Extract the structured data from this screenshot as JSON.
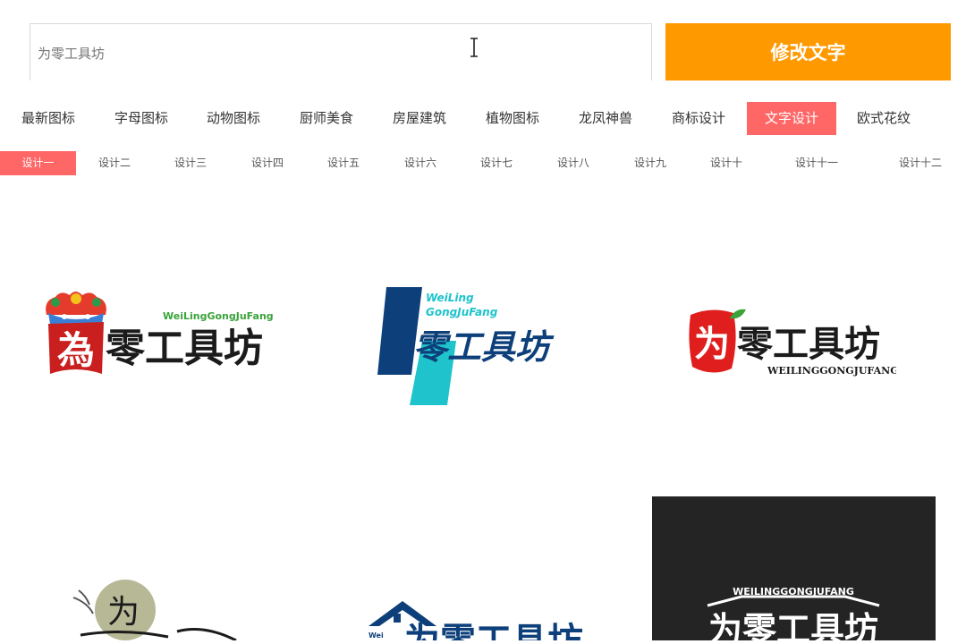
{
  "search": {
    "value": "为零工具坊",
    "button_label": "修改文字"
  },
  "categories": [
    {
      "label": "最新图标",
      "active": false
    },
    {
      "label": "字母图标",
      "active": false
    },
    {
      "label": "动物图标",
      "active": false
    },
    {
      "label": "厨师美食",
      "active": false
    },
    {
      "label": "房屋建筑",
      "active": false
    },
    {
      "label": "植物图标",
      "active": false
    },
    {
      "label": "龙凤神兽",
      "active": false
    },
    {
      "label": "商标设计",
      "active": false
    },
    {
      "label": "文字设计",
      "active": true
    },
    {
      "label": "欧式花纹",
      "active": false
    }
  ],
  "designs": [
    {
      "label": "设计一",
      "active": true
    },
    {
      "label": "设计二",
      "active": false
    },
    {
      "label": "设计三",
      "active": false
    },
    {
      "label": "设计四",
      "active": false
    },
    {
      "label": "设计五",
      "active": false
    },
    {
      "label": "设计六",
      "active": false
    },
    {
      "label": "设计七",
      "active": false
    },
    {
      "label": "设计八",
      "active": false
    },
    {
      "label": "设计九",
      "active": false
    },
    {
      "label": "设计十",
      "active": false
    },
    {
      "label": "设计十一",
      "active": false
    },
    {
      "label": "设计十二",
      "active": false
    }
  ],
  "logos": {
    "logo1": {
      "pinyin": "WeiLingGongJuFang",
      "first_char": "為",
      "rest": "零工具坊"
    },
    "logo2": {
      "pinyin_line1": "WeiLing",
      "pinyin_line2": "GongJuFang",
      "text": "为零工具坊"
    },
    "logo3": {
      "first_char": "为",
      "rest": "零工具坊",
      "pinyin": "WEILINGGONGJUFANG"
    },
    "logo4": {
      "first_char": "为"
    },
    "logo5": {
      "pinyin": "Wei",
      "text": "为零工具坊"
    },
    "logo6": {
      "pinyin": "WEILINGGONGJUFANG",
      "text": "为零工具坊"
    }
  },
  "colors": {
    "accent_orange": "#ff9900",
    "active_tab": "#ff6666",
    "logo_green": "#3aa33a",
    "logo_navy": "#0d3f7a",
    "logo_teal": "#1ec3cc",
    "logo_red": "#e01e1e"
  }
}
